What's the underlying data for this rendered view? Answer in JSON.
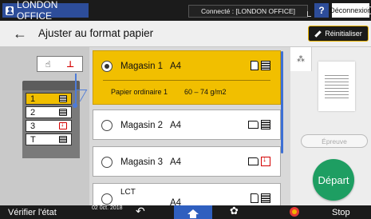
{
  "top": {
    "user": "LONDON OFFICE",
    "connection": "Connecté : [LONDON OFFICE]",
    "help": "?",
    "logout": "Déconnexion"
  },
  "header": {
    "back": "←",
    "title": "Ajuster au format papier",
    "reset": "Réinitialiser"
  },
  "printer": {
    "trays": [
      {
        "label": "1",
        "selected": true,
        "status": "loaded"
      },
      {
        "label": "2",
        "selected": false,
        "status": "loaded"
      },
      {
        "label": "3",
        "selected": false,
        "status": "empty"
      },
      {
        "label": "T",
        "selected": false,
        "status": "loaded"
      }
    ]
  },
  "trays": [
    {
      "name": "Magasin 1",
      "size": "A4",
      "selected": true,
      "paper_type": "Papier ordinaire 1",
      "weight": "60 – 74 g/m2",
      "orientation": "portrait",
      "status": "loaded"
    },
    {
      "name": "Magasin 2",
      "size": "A4",
      "selected": false,
      "orientation": "landscape",
      "status": "loaded"
    },
    {
      "name": "Magasin 3",
      "size": "A4",
      "selected": false,
      "orientation": "landscape",
      "status": "empty"
    },
    {
      "name": "LCT",
      "size": "A4",
      "selected": false,
      "orientation": "portrait",
      "status": "loaded"
    }
  ],
  "side": {
    "proof": "Épreuve",
    "start": "Départ"
  },
  "bottom": {
    "check_status": "Vérifier l'état",
    "date": "02 0ct. 2018",
    "stop": "Stop"
  },
  "colors": {
    "selected": "#f1bf00",
    "start": "#1e9e62",
    "home": "#2f5fbf",
    "accent_blue": "#3d6fd4"
  }
}
